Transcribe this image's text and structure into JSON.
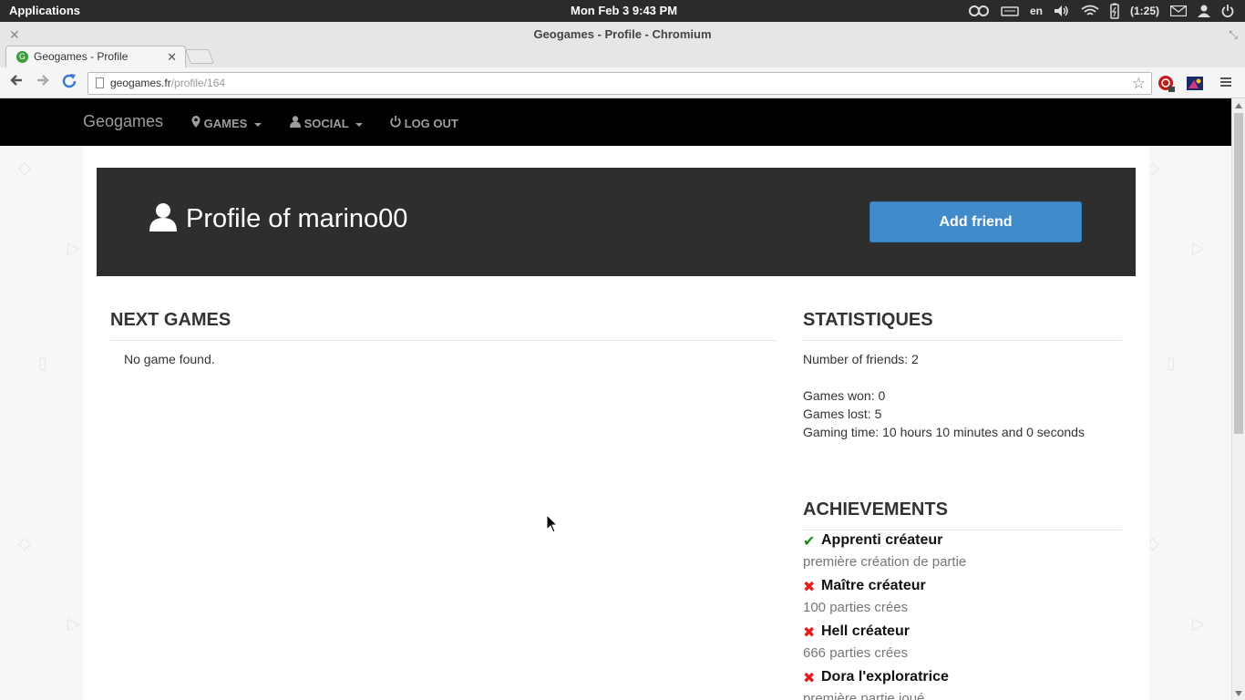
{
  "os": {
    "applications_label": "Applications",
    "clock": "Mon Feb  3  9:43 PM",
    "keyboard_layout": "en",
    "battery_time": "(1:25)"
  },
  "window": {
    "title": "Geogames - Profile - Chromium"
  },
  "tab": {
    "title": "Geogames - Profile"
  },
  "address_bar": {
    "host": "geogames.fr",
    "path": "/profile/164"
  },
  "site_nav": {
    "brand": "Geogames",
    "games_label": "GAMES",
    "social_label": "SOCIAL",
    "logout_label": "LOG OUT"
  },
  "profile": {
    "title": "Profile of marino00",
    "add_friend_label": "Add friend"
  },
  "next_games": {
    "heading": "NEXT GAMES",
    "empty_text": "No game found."
  },
  "stats": {
    "heading": "STATISTIQUES",
    "friends": "Number of friends: 2",
    "won": "Games won: 0",
    "lost": "Games lost: 5",
    "time": "Gaming time: 10 hours 10 minutes and 0 seconds"
  },
  "achievements": {
    "heading": "ACHIEVEMENTS",
    "items": [
      {
        "name": "Apprenti créateur",
        "desc": "première création de partie",
        "unlocked": true,
        "icon": "check-icon"
      },
      {
        "name": "Maître créateur",
        "desc": "100 parties crées",
        "unlocked": false,
        "icon": "cross-icon"
      },
      {
        "name": "Hell créateur",
        "desc": "666 parties crées",
        "unlocked": false,
        "icon": "cross-icon"
      },
      {
        "name": "Dora l'exploratrice",
        "desc": "première partie joué",
        "unlocked": false,
        "icon": "cross-icon"
      }
    ]
  },
  "colors": {
    "primary_button": "#428bca",
    "banner": "#2e2e2e",
    "navbar": "#000000",
    "achieved": "#1a8a1a",
    "not_achieved": "#e02020"
  }
}
